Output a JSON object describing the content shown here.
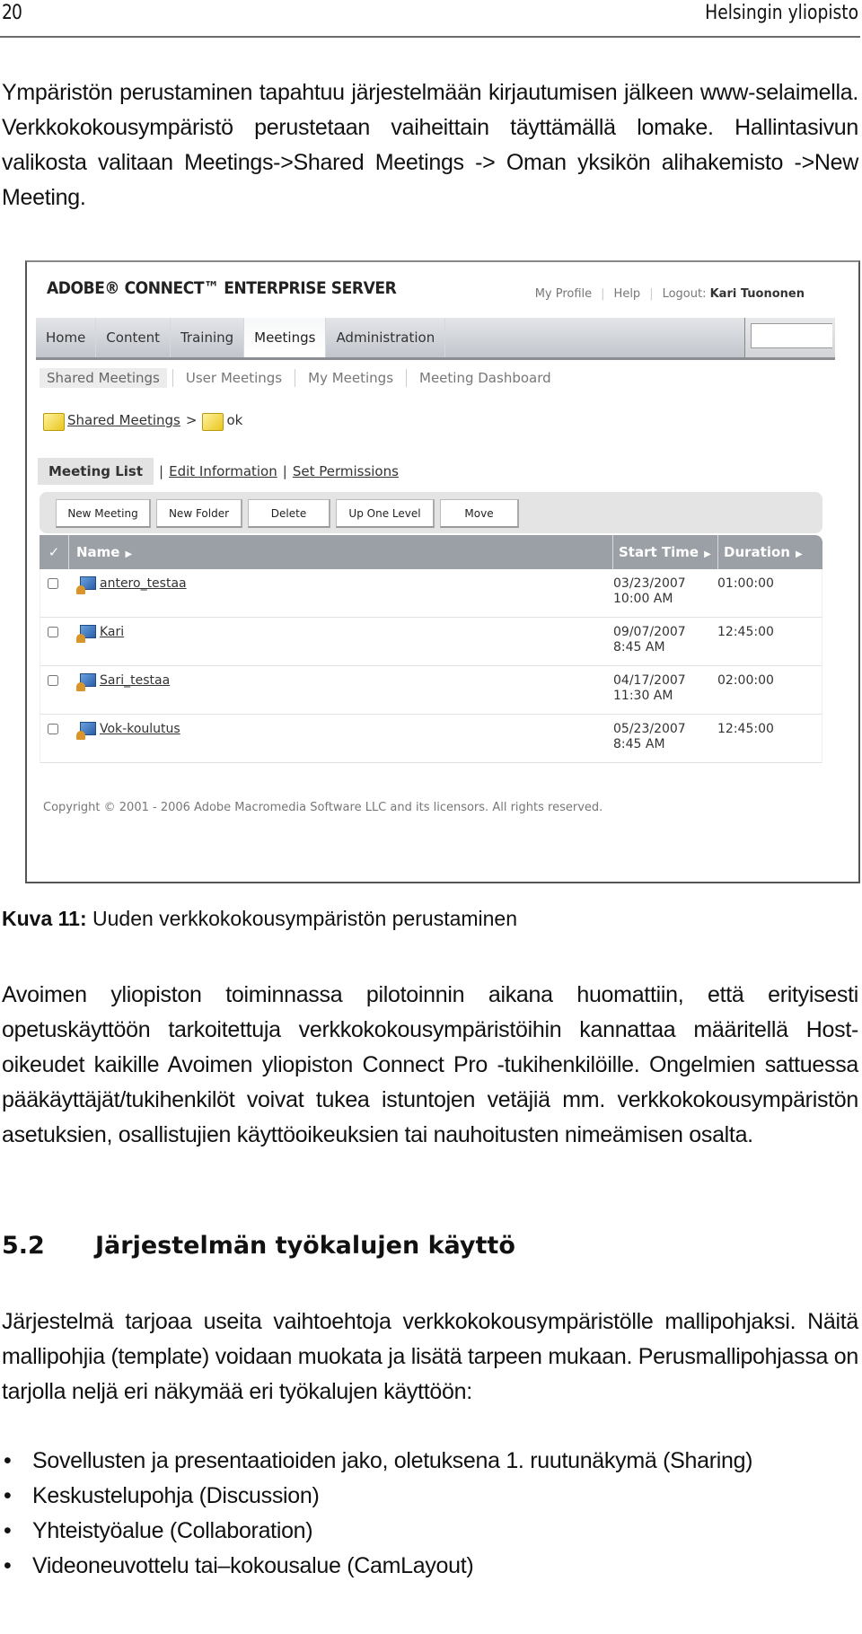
{
  "header": {
    "page_number": "20",
    "publisher": "Helsingin yliopisto"
  },
  "intro_paragraph": "Ympäristön perustaminen tapahtuu järjestelmään kirjautumisen jälkeen www-selaimella. Verkkokokousympäristö perustetaan vaiheittain täyttä­mällä lomake. Hallintasivun valikosta valitaan Meetings->Shared Mee­tings -> Oman yksikön alihakemisto ->New Meeting.",
  "screenshot": {
    "brand": "ADOBE® CONNECT™ ENTERPRISE SERVER",
    "top_links": {
      "my_profile": "My Profile",
      "help": "Help",
      "logout_label": "Logout:",
      "user_name": "Kari Tuononen"
    },
    "nav_tabs": [
      {
        "label": "Home",
        "active": false
      },
      {
        "label": "Content",
        "active": false
      },
      {
        "label": "Training",
        "active": false
      },
      {
        "label": "Meetings",
        "active": true
      },
      {
        "label": "Administration",
        "active": false
      }
    ],
    "search_value": "",
    "sub_nav": [
      {
        "label": "Shared Meetings",
        "active": true
      },
      {
        "label": "User Meetings",
        "active": false
      },
      {
        "label": "My Meetings",
        "active": false
      },
      {
        "label": "Meeting Dashboard",
        "active": false
      }
    ],
    "breadcrumb": {
      "root": "Shared Meetings",
      "separator": ">",
      "current": "ok"
    },
    "view_tabs": {
      "current": "Meeting List",
      "edit_information": "Edit Information",
      "set_permissions": "Set Permissions",
      "separator": "|"
    },
    "toolbar": {
      "new_meeting": "New Meeting",
      "new_folder": "New Folder",
      "delete": "Delete",
      "up_one_level": "Up One Level",
      "move": "Move"
    },
    "table": {
      "columns": {
        "check": "✓",
        "name": "Name",
        "start_time": "Start Time",
        "duration": "Duration"
      },
      "rows": [
        {
          "name": "antero_testaa",
          "date": "03/23/2007",
          "time": "10:00 AM",
          "duration": "01:00:00",
          "checked": false
        },
        {
          "name": "Kari",
          "date": "09/07/2007",
          "time": "8:45 AM",
          "duration": "12:45:00",
          "checked": false
        },
        {
          "name": "Sari_testaa",
          "date": "04/17/2007",
          "time": "11:30 AM",
          "duration": "02:00:00",
          "checked": false
        },
        {
          "name": "Vok-koulutus",
          "date": "05/23/2007",
          "time": "8:45 AM",
          "duration": "12:45:00",
          "checked": false
        }
      ]
    },
    "copyright": "Copyright © 2001 - 2006 Adobe Macromedia Software LLC and its licensors. All rights reserved.",
    "colors": {
      "table_header": "#9aa0a5",
      "toolbar_bg": "#e4e4e4",
      "folder": "#e9c61c"
    }
  },
  "caption": {
    "label": "Kuva 11:",
    "text": " Uuden verkkokokousympäristön perustaminen"
  },
  "paragraph_2": "Avoimen yliopiston toiminnassa pilotoinnin aikana huomattiin, että eri­tyisesti opetuskäyttöön tarkoitettuja verkkokokousympäristöihin kannat­taa määritellä Host-oikeudet kaikille Avoimen yliopiston Connect Pro -tu­kihenkilöille. Ongelmien sattuessa pääkäyttäjät/tukihenkilöt voivat tukea istuntojen vetäjiä mm. verkkokokousympäristön asetuksien, osallistujien käyttöoikeuksien tai nauhoitusten nimeämisen osalta.",
  "section": {
    "number": "5.2",
    "title": "Järjestelmän työkalujen käyttö"
  },
  "paragraph_3": "Järjestelmä tarjoaa useita vaihtoehtoja verkkokokousympäristölle malli­pohjaksi. Näitä mallipohjia (template) voidaan muokata ja lisätä tarpeen mukaan. Perusmallipohjassa on tarjolla neljä eri näkymää eri työkalujen käyttöön:",
  "bullets": [
    "Sovellusten ja presentaatioiden jako, oletuksena 1. ruutunäkymä (Sha­ring)",
    "Keskustelupohja (Discussion)",
    "Yhteistyöalue (Collaboration)",
    "Videoneuvottelu tai–kokousalue (CamLayout)"
  ]
}
